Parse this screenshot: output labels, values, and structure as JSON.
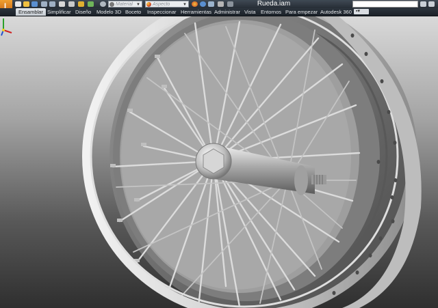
{
  "window": {
    "document_title": "Rueda.iam"
  },
  "quick_access": {
    "material_placeholder": "Material",
    "appearance_placeholder": "Aspecto"
  },
  "ribbon": {
    "tabs": [
      {
        "label": "Ensamblar",
        "active": true
      },
      {
        "label": "Simplificar"
      },
      {
        "label": "Diseño"
      },
      {
        "label": "Modelo 3D"
      },
      {
        "label": "Boceto"
      },
      {
        "label": "Inspeccionar"
      },
      {
        "label": "Herramientas"
      },
      {
        "label": "Administrar"
      },
      {
        "label": "Vista"
      },
      {
        "label": "Entornos"
      },
      {
        "label": "Para empezar"
      },
      {
        "label": "Autodesk 360"
      }
    ]
  },
  "viewport": {
    "model": "wheel",
    "background": "gradient-gray"
  },
  "colors": {
    "app_button": "#e07a20",
    "ribbon_dark": "#262d35",
    "active_tab": "#d9dde2"
  }
}
